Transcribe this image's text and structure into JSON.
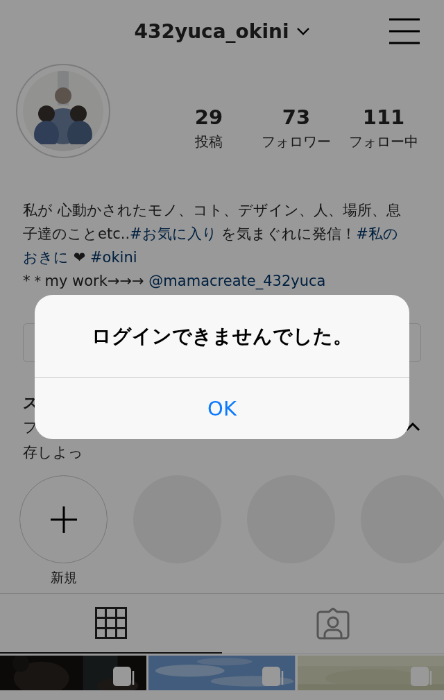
{
  "header": {
    "username": "432yuca_okini"
  },
  "stats": [
    {
      "value": "29",
      "label": "投稿"
    },
    {
      "value": "73",
      "label": "フォロワー"
    },
    {
      "value": "111",
      "label": "フォロー中"
    }
  ],
  "bio": [
    [
      {
        "kind": "text",
        "text": "私が 心動かされたモノ、コト、デザイン、人、場所、息"
      }
    ],
    [
      {
        "kind": "text",
        "text": "子達のことetc.."
      },
      {
        "kind": "tag",
        "text": "#お気に入り"
      },
      {
        "kind": "text",
        "text": " を気まぐれに発信！"
      },
      {
        "kind": "tag",
        "text": "#私の"
      }
    ],
    [
      {
        "kind": "tag",
        "text": "おきに"
      },
      {
        "kind": "text",
        "text": " ❤ "
      },
      {
        "kind": "tag",
        "text": "#okini"
      }
    ],
    [
      {
        "kind": "text",
        "text": "*＊my work→→→ "
      },
      {
        "kind": "tag",
        "text": "@mamacreate_432yuca"
      }
    ]
  ],
  "stories": {
    "title": "ス",
    "subtitle": [
      "フ",
      "存しよっ"
    ],
    "expanded": true,
    "highlights": [
      {
        "kind": "new",
        "label": "新規"
      },
      {
        "kind": "empty"
      },
      {
        "kind": "empty"
      },
      {
        "kind": "empty"
      }
    ]
  },
  "tabs": [
    {
      "kind": "grid",
      "selected": true
    },
    {
      "kind": "tagged",
      "selected": false
    }
  ],
  "posts": [
    {
      "kind": "picture",
      "multiple": true
    },
    {
      "kind": "picture",
      "multiple": true
    },
    {
      "kind": "picture",
      "multiple": true
    }
  ],
  "dialog": {
    "message": "ログインできませんでした。",
    "button": "OK"
  }
}
